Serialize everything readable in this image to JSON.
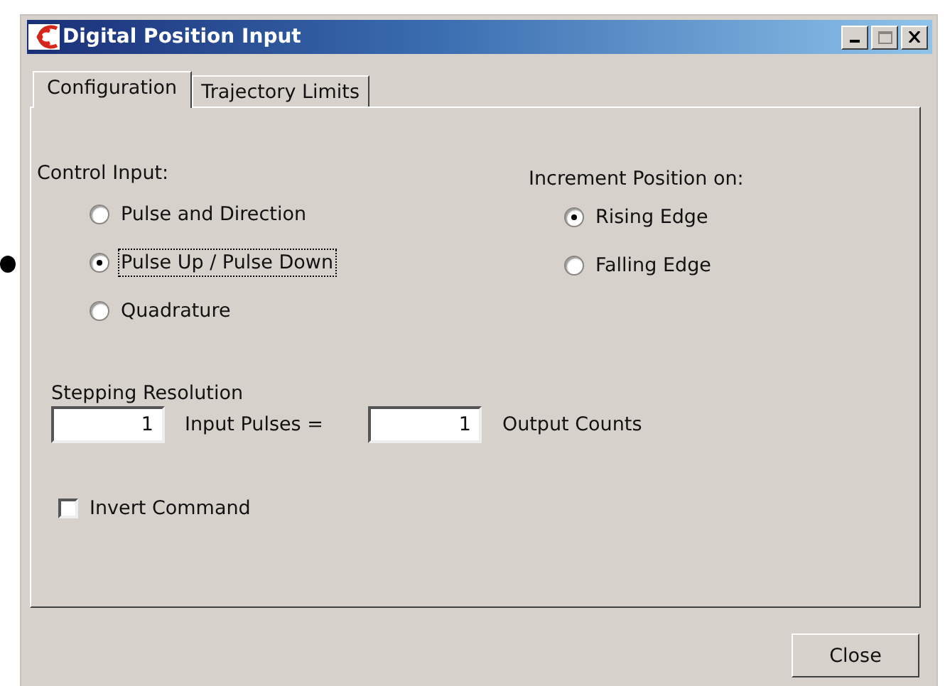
{
  "window": {
    "title": "Digital Position Input"
  },
  "tabs": [
    {
      "label": "Configuration",
      "selected": true
    },
    {
      "label": "Trajectory Limits",
      "selected": false
    }
  ],
  "control_input": {
    "label": "Control Input:",
    "options": [
      {
        "label": "Pulse and Direction",
        "selected": false
      },
      {
        "label": "Pulse Up / Pulse Down",
        "selected": true
      },
      {
        "label": "Quadrature",
        "selected": false
      }
    ]
  },
  "increment_position": {
    "label": "Increment Position on:",
    "options": [
      {
        "label": "Rising Edge",
        "selected": true
      },
      {
        "label": "Falling Edge",
        "selected": false
      }
    ]
  },
  "stepping_resolution": {
    "label": "Stepping Resolution",
    "input_value": "1",
    "input_label": "Input Pulses =",
    "output_value": "1",
    "output_label": "Output Counts"
  },
  "invert_command": {
    "label": "Invert Command",
    "checked": false
  },
  "buttons": [
    {
      "label": "Close"
    }
  ]
}
